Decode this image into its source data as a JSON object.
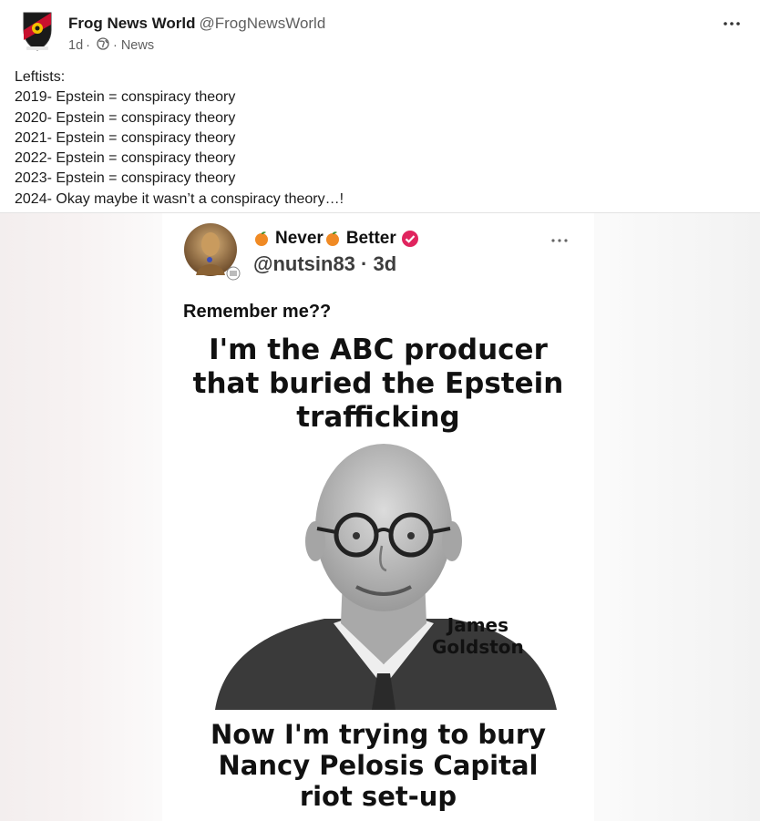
{
  "post": {
    "author_name": "Frog News World",
    "author_handle": "@FrogNewsWorld",
    "age": "1d",
    "separator": "·",
    "category": "News",
    "icons": {
      "more": "more-horizontal-icon",
      "audience": "globe-icon",
      "avatar": "shield-logo-icon"
    },
    "text_lines": [
      "Leftists:",
      "2019- Epstein = conspiracy theory",
      "2020- Epstein = conspiracy theory",
      "2021- Epstein = conspiracy theory",
      "2022- Epstein = conspiracy theory",
      "2023- Epstein = conspiracy theory",
      "2024- Okay maybe it wasn’t a conspiracy theory…!"
    ]
  },
  "meme": {
    "tweet_name_part1": "Never",
    "tweet_name_part2": "Better",
    "tweet_handle": "@nutsin83",
    "tweet_time": "3d",
    "tweet_separator": "·",
    "remember": "Remember me??",
    "headline_top": [
      "I'm the ABC producer",
      "that buried the Epstein",
      "trafficking"
    ],
    "person_name": [
      "James",
      "Goldston"
    ],
    "headline_bottom": [
      "Now I'm trying to bury",
      "Nancy Pelosis Capital",
      "riot set-up"
    ],
    "colors": {
      "verified": "#e0245e",
      "peach": "#f08a24"
    }
  }
}
